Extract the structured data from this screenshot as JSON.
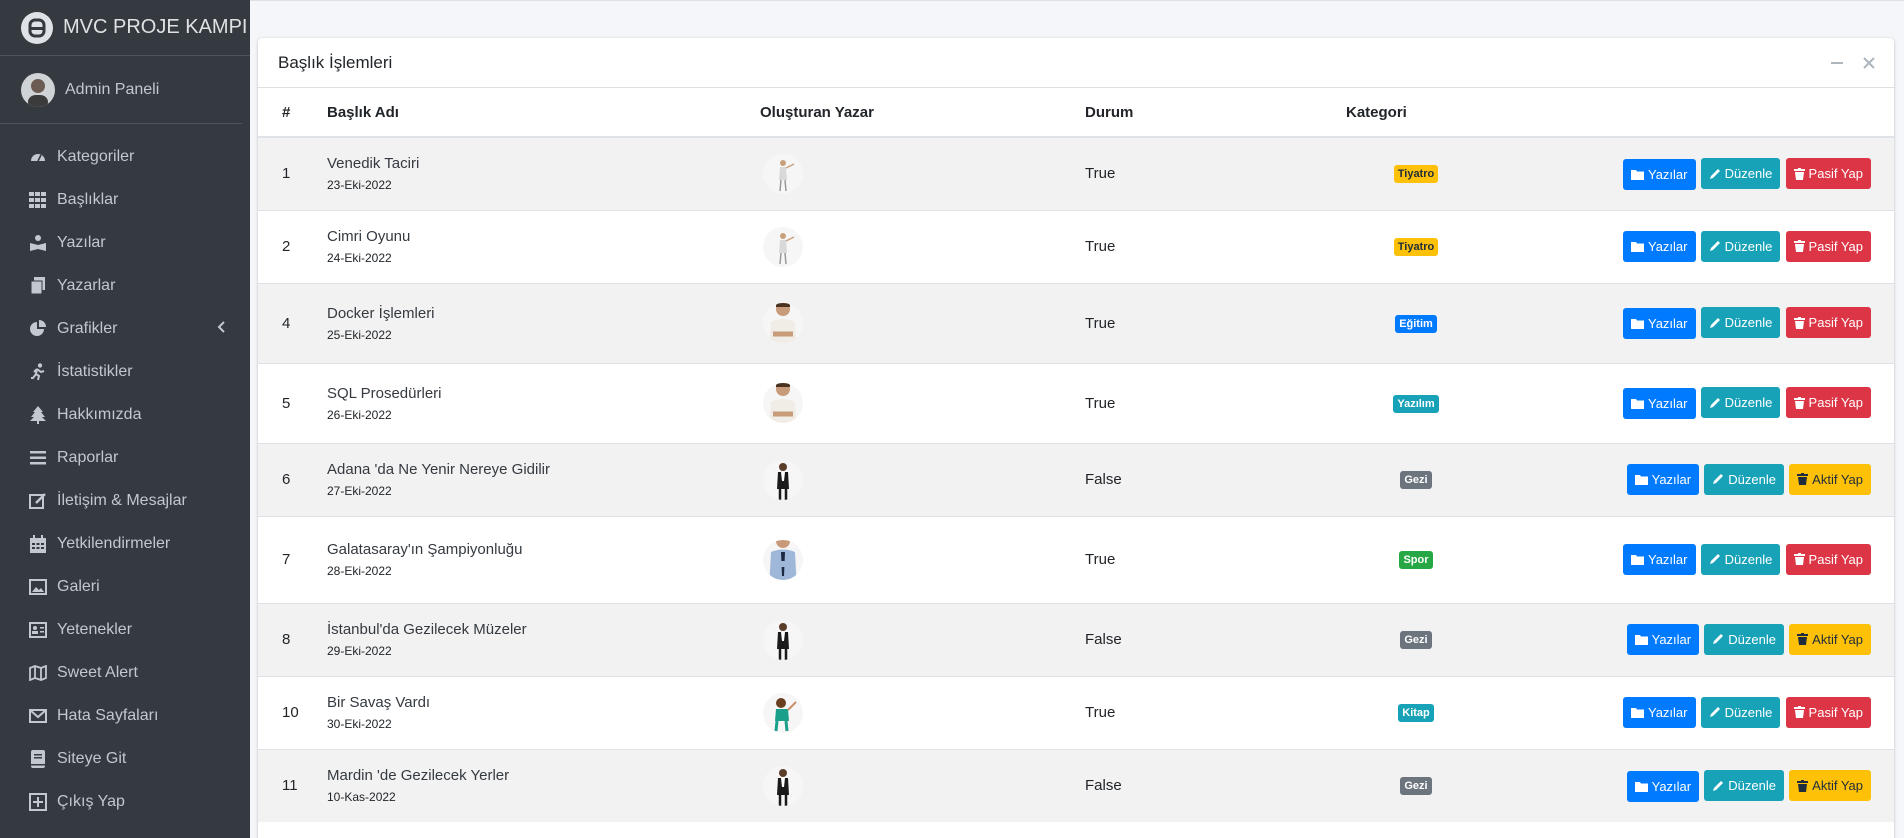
{
  "sidebar": {
    "brand": "MVC PROJE KAMPI",
    "user": "Admin Paneli",
    "items": [
      {
        "label": "Kategoriler",
        "icon": "dashboard-icon"
      },
      {
        "label": "Başlıklar",
        "icon": "grid-icon"
      },
      {
        "label": "Yazılar",
        "icon": "reader-icon"
      },
      {
        "label": "Yazarlar",
        "icon": "copy-icon"
      },
      {
        "label": "Grafikler",
        "icon": "pie-chart-icon"
      },
      {
        "label": "İstatistikler",
        "icon": "running-icon"
      },
      {
        "label": "Hakkımızda",
        "icon": "tree-icon"
      },
      {
        "label": "Raporlar",
        "icon": "list-icon"
      },
      {
        "label": "İletişim & Mesajlar",
        "icon": "edit-icon"
      },
      {
        "label": "Yetkilendirmeler",
        "icon": "calendar-icon"
      },
      {
        "label": "Galeri",
        "icon": "image-icon"
      },
      {
        "label": "Yetenekler",
        "icon": "id-card-icon"
      },
      {
        "label": "Sweet Alert",
        "icon": "map-icon"
      },
      {
        "label": "Hata Sayfaları",
        "icon": "envelope-icon"
      },
      {
        "label": "Siteye Git",
        "icon": "book-icon"
      },
      {
        "label": "Çıkış Yap",
        "icon": "plus-square-icon"
      }
    ]
  },
  "card": {
    "title": "Başlık İşlemleri"
  },
  "table": {
    "headers": {
      "num": "#",
      "title": "Başlık Adı",
      "author": "Oluşturan Yazar",
      "status": "Durum",
      "category": "Kategori"
    },
    "rows": [
      {
        "id": "1",
        "title": "Venedik Taciri",
        "date": "23-Eki-2022",
        "status": "True",
        "category": "Tiyatro",
        "cat_color": "#ffc107",
        "cat_text": "#1f2d3d",
        "toggle": "Pasif Yap"
      },
      {
        "id": "2",
        "title": "Cimri Oyunu",
        "date": "24-Eki-2022",
        "status": "True",
        "category": "Tiyatro",
        "cat_color": "#ffc107",
        "cat_text": "#1f2d3d",
        "toggle": "Pasif Yap"
      },
      {
        "id": "4",
        "title": "Docker İşlemleri",
        "date": "25-Eki-2022",
        "status": "True",
        "category": "Eğitim",
        "cat_color": "#007bff",
        "cat_text": "#ffffff",
        "toggle": "Pasif Yap"
      },
      {
        "id": "5",
        "title": "SQL Prosedürleri",
        "date": "26-Eki-2022",
        "status": "True",
        "category": "Yazılım",
        "cat_color": "#17a2b8",
        "cat_text": "#ffffff",
        "toggle": "Pasif Yap"
      },
      {
        "id": "6",
        "title": "Adana 'da Ne Yenir Nereye Gidilir",
        "date": "27-Eki-2022",
        "status": "False",
        "category": "Gezi",
        "cat_color": "#6c757d",
        "cat_text": "#ffffff",
        "toggle": "Aktif Yap"
      },
      {
        "id": "7",
        "title": "Galatasaray'ın Şampiyonluğu",
        "date": "28-Eki-2022",
        "status": "True",
        "category": "Spor",
        "cat_color": "#28a745",
        "cat_text": "#ffffff",
        "toggle": "Pasif Yap"
      },
      {
        "id": "8",
        "title": "İstanbul'da Gezilecek Müzeler",
        "date": "29-Eki-2022",
        "status": "False",
        "category": "Gezi",
        "cat_color": "#6c757d",
        "cat_text": "#ffffff",
        "toggle": "Aktif Yap"
      },
      {
        "id": "10",
        "title": "Bir Savaş Vardı",
        "date": "30-Eki-2022",
        "status": "True",
        "category": "Kitap",
        "cat_color": "#17a2b8",
        "cat_text": "#ffffff",
        "toggle": "Pasif Yap"
      },
      {
        "id": "11",
        "title": "Mardin 'de Gezilecek Yerler",
        "date": "10-Kas-2022",
        "status": "False",
        "category": "Gezi",
        "cat_color": "#6c757d",
        "cat_text": "#ffffff",
        "toggle": "Aktif Yap"
      }
    ]
  },
  "buttons": {
    "posts": "Yazılar",
    "edit": "Düzenle"
  },
  "colors": {
    "primary": "#007bff",
    "info": "#17a2b8",
    "danger": "#dc3545",
    "warning": "#ffc107",
    "sidebar": "#343a40"
  }
}
